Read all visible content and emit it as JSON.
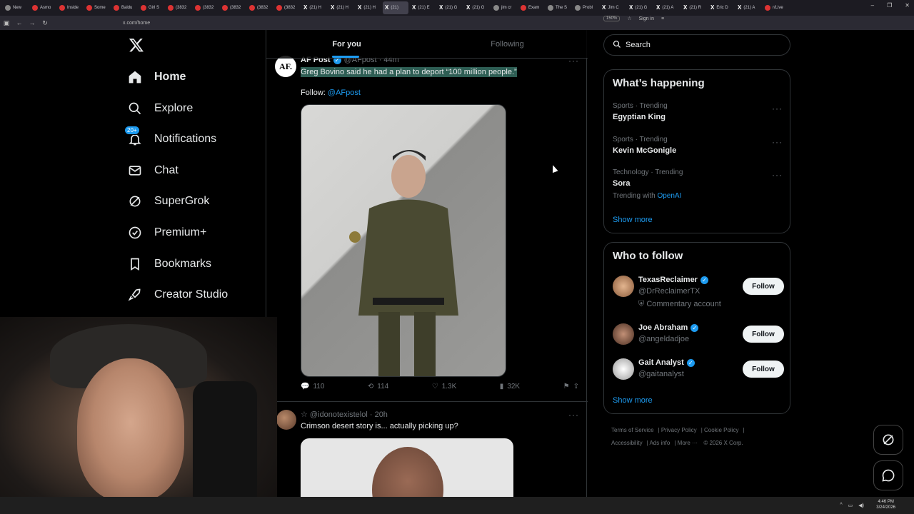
{
  "browser": {
    "tabs": [
      {
        "label": "New"
      },
      {
        "label": "Asmo"
      },
      {
        "label": "Inside"
      },
      {
        "label": "Some"
      },
      {
        "label": "Baldu"
      },
      {
        "label": "Girl S"
      },
      {
        "label": "(3832"
      },
      {
        "label": "(3832"
      },
      {
        "label": "(3832"
      },
      {
        "label": "(3832"
      },
      {
        "label": "(3832"
      },
      {
        "label": "(21) H"
      },
      {
        "label": "(21) H"
      },
      {
        "label": "(21) H"
      },
      {
        "label": "(21)"
      },
      {
        "label": "(21) E"
      },
      {
        "label": "(21) G"
      },
      {
        "label": "(21) G"
      },
      {
        "label": "jim cr"
      },
      {
        "label": "Exam"
      },
      {
        "label": "The S"
      },
      {
        "label": "Probl"
      },
      {
        "label": "Jim C"
      },
      {
        "label": "(21) G"
      },
      {
        "label": "(21) A"
      },
      {
        "label": "(21) R"
      },
      {
        "label": "Eric D"
      },
      {
        "label": "(21) A"
      },
      {
        "label": "r/Live"
      }
    ],
    "url": "x.com/home",
    "zoom": "150%",
    "sign_in": "Sign in"
  },
  "sidebar": {
    "items": [
      {
        "label": "Home"
      },
      {
        "label": "Explore"
      },
      {
        "label": "Notifications",
        "badge": "20+"
      },
      {
        "label": "Chat"
      },
      {
        "label": "SuperGrok"
      },
      {
        "label": "Premium+"
      },
      {
        "label": "Bookmarks"
      },
      {
        "label": "Creator Studio"
      }
    ]
  },
  "timeline": {
    "tabs": [
      {
        "label": "For you"
      },
      {
        "label": "Following"
      }
    ],
    "post1": {
      "avatar_text": "AF.",
      "name": "AF Post",
      "handle": "@AFpost · 44m",
      "text": "Greg Bovino said he had a plan to deport “100 million people.”",
      "follow_prefix": "Follow: ",
      "follow_mention": "@AFpost",
      "replies": "110",
      "reposts": "114",
      "likes": "1.3K",
      "views": "32K"
    },
    "post2": {
      "header": "☆ @idonotexistelol · 20h",
      "text": "Crimson desert story is... actually picking up?"
    }
  },
  "right": {
    "search_placeholder": "Search",
    "trending": {
      "title": "What’s happening",
      "items": [
        {
          "category": "Sports · Trending",
          "topic": "Egyptian King"
        },
        {
          "category": "Sports · Trending",
          "topic": "Kevin McGonigle"
        },
        {
          "category": "Technology · Trending",
          "topic": "Sora",
          "with_prefix": "Trending with ",
          "with": "OpenAI"
        }
      ],
      "show_more": "Show more"
    },
    "who_to_follow": {
      "title": "Who to follow",
      "items": [
        {
          "name": "TexasReclaimer",
          "handle": "@DrReclaimerTX",
          "extra": "Commentary account",
          "button": "Follow"
        },
        {
          "name": "Joe Abraham",
          "handle": "@angeldadjoe",
          "button": "Follow"
        },
        {
          "name": "Gait Analyst",
          "handle": "@gaitanalyst",
          "button": "Follow"
        }
      ],
      "show_more": "Show more"
    },
    "footer": {
      "links": [
        "Terms of Service",
        "Privacy Policy",
        "Cookie Policy",
        "Accessibility",
        "Ads info",
        "More ···"
      ],
      "copyright": "© 2026 X Corp."
    }
  },
  "taskbar": {
    "time": "4:46 PM",
    "date": "3/24/2026"
  },
  "colors": {
    "accent": "#1d9bf0",
    "background": "#000000",
    "border": "#2f3336",
    "muted": "#71767b",
    "highlight": "#2e5e54"
  }
}
